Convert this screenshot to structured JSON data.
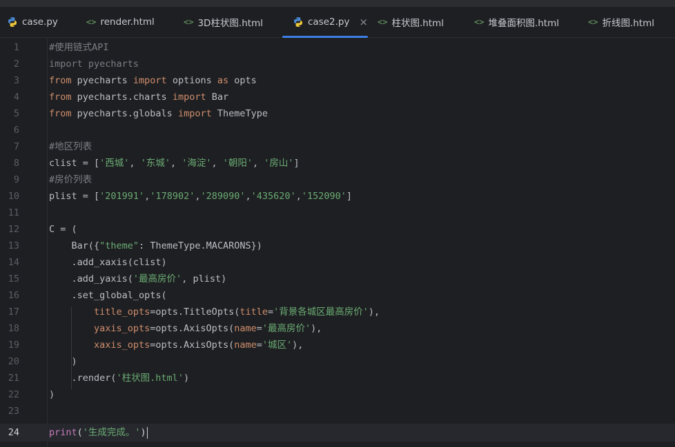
{
  "tabs": [
    {
      "label": "case.py",
      "icon": "python-icon"
    },
    {
      "label": "render.html",
      "icon": "html-icon"
    },
    {
      "label": "3D柱状图.html",
      "icon": "html-icon"
    },
    {
      "label": "case2.py",
      "icon": "python-icon",
      "active": true
    },
    {
      "label": "柱状图.html",
      "icon": "html-icon"
    },
    {
      "label": "堆叠面积图.html",
      "icon": "html-icon"
    },
    {
      "label": "折线图.html",
      "icon": "html-icon"
    }
  ],
  "close_glyph": "×",
  "html_icon_glyph": "<>",
  "lines": {
    "l1": "#使用链式API",
    "l2": "import pyecharts",
    "l3": {
      "a": "from",
      "b": " pyecharts ",
      "c": "import",
      "d": " options ",
      "e": "as",
      "f": " opts"
    },
    "l4": {
      "a": "from",
      "b": " pyecharts.charts ",
      "c": "import",
      "d": " Bar"
    },
    "l5": {
      "a": "from",
      "b": " pyecharts.globals ",
      "c": "import",
      "d": " ThemeType"
    },
    "l7": "#地区列表",
    "l8": {
      "a": "clist = [",
      "s1": "'西城'",
      "c1": ", ",
      "s2": "'东城'",
      "c2": ", ",
      "s3": "'海淀'",
      "c3": ", ",
      "s4": "'朝阳'",
      "c4": ", ",
      "s5": "'房山'",
      "e": "]"
    },
    "l9": "#房价列表",
    "l10": {
      "a": "plist = [",
      "s1": "'201991'",
      "c1": ",",
      "s2": "'178902'",
      "c2": ",",
      "s3": "'289090'",
      "c3": ",",
      "s4": "'435620'",
      "c4": ",",
      "s5": "'152090'",
      "e": "]"
    },
    "l12": "C = (",
    "l13": {
      "a": "    Bar({",
      "s": "\"theme\"",
      "b": ": ThemeType.MACARONS})"
    },
    "l14": "    .add_xaxis(clist)",
    "l15": {
      "a": "    .add_yaxis(",
      "s": "'最高房价'",
      "b": ", plist)"
    },
    "l16": "    .set_global_opts(",
    "l17": {
      "p": "title_opts",
      "a": "=opts.TitleOpts(",
      "p2": "title",
      "eq": "=",
      "s": "'背景各城区最高房价'",
      "b": "),"
    },
    "l18": {
      "p": "yaxis_opts",
      "a": "=opts.AxisOpts(",
      "p2": "name",
      "eq": "=",
      "s": "'最高房价'",
      "b": "),"
    },
    "l19": {
      "p": "xaxis_opts",
      "a": "=opts.AxisOpts(",
      "p2": "name",
      "eq": "=",
      "s": "'城区'",
      "b": "),"
    },
    "l20": "    )",
    "l21": {
      "a": "    .render(",
      "s": "'柱状图.html'",
      "b": ")"
    },
    "l22": ")",
    "l24": {
      "a": "print",
      "p1": "(",
      "s": "'生成完成。'",
      "p2": ")"
    }
  },
  "line_numbers": [
    "1",
    "2",
    "3",
    "4",
    "5",
    "6",
    "7",
    "8",
    "9",
    "10",
    "11",
    "12",
    "13",
    "14",
    "15",
    "16",
    "17",
    "18",
    "19",
    "20",
    "21",
    "22",
    "23",
    "24"
  ],
  "current_line": 24
}
